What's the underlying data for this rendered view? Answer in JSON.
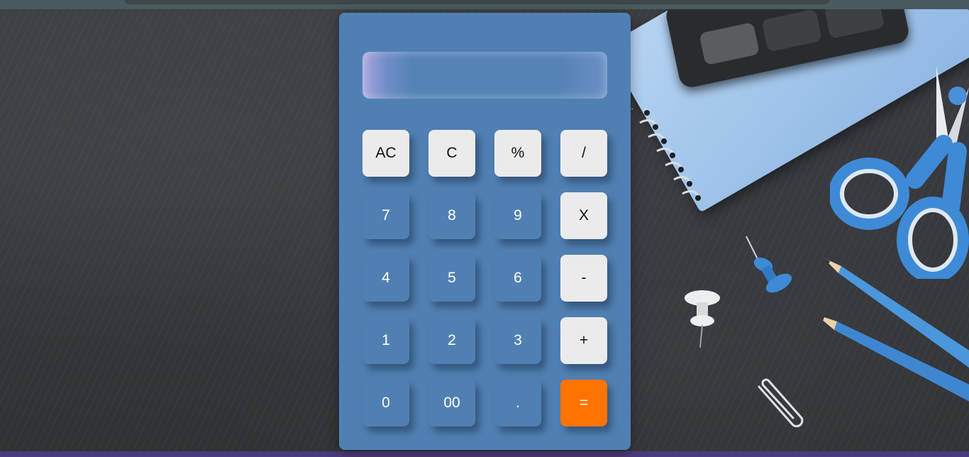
{
  "display": {
    "value": ""
  },
  "keys": {
    "row1": [
      {
        "label": "AC",
        "name": "all-clear-button",
        "style": "light"
      },
      {
        "label": "C",
        "name": "clear-button",
        "style": "light"
      },
      {
        "label": "%",
        "name": "percent-button",
        "style": "light"
      },
      {
        "label": "/",
        "name": "divide-button",
        "style": "light"
      }
    ],
    "row2": [
      {
        "label": "7",
        "name": "digit-7-button",
        "style": "blue"
      },
      {
        "label": "8",
        "name": "digit-8-button",
        "style": "blue"
      },
      {
        "label": "9",
        "name": "digit-9-button",
        "style": "blue"
      },
      {
        "label": "X",
        "name": "multiply-button",
        "style": "light"
      }
    ],
    "row3": [
      {
        "label": "4",
        "name": "digit-4-button",
        "style": "blue"
      },
      {
        "label": "5",
        "name": "digit-5-button",
        "style": "blue"
      },
      {
        "label": "6",
        "name": "digit-6-button",
        "style": "blue"
      },
      {
        "label": "-",
        "name": "subtract-button",
        "style": "light"
      }
    ],
    "row4": [
      {
        "label": "1",
        "name": "digit-1-button",
        "style": "blue"
      },
      {
        "label": "2",
        "name": "digit-2-button",
        "style": "blue"
      },
      {
        "label": "3",
        "name": "digit-3-button",
        "style": "blue"
      },
      {
        "label": "+",
        "name": "add-button",
        "style": "light"
      }
    ],
    "row5": [
      {
        "label": "0",
        "name": "digit-0-button",
        "style": "blue"
      },
      {
        "label": "00",
        "name": "double-zero-button",
        "style": "blue"
      },
      {
        "label": ".",
        "name": "decimal-point-button",
        "style": "blue"
      },
      {
        "label": "=",
        "name": "equals-button",
        "style": "orange"
      }
    ]
  },
  "colors": {
    "panel": "#5080b3",
    "light_key": "#ebebeb",
    "equals_key": "#ff7300",
    "background": "#35373b"
  }
}
